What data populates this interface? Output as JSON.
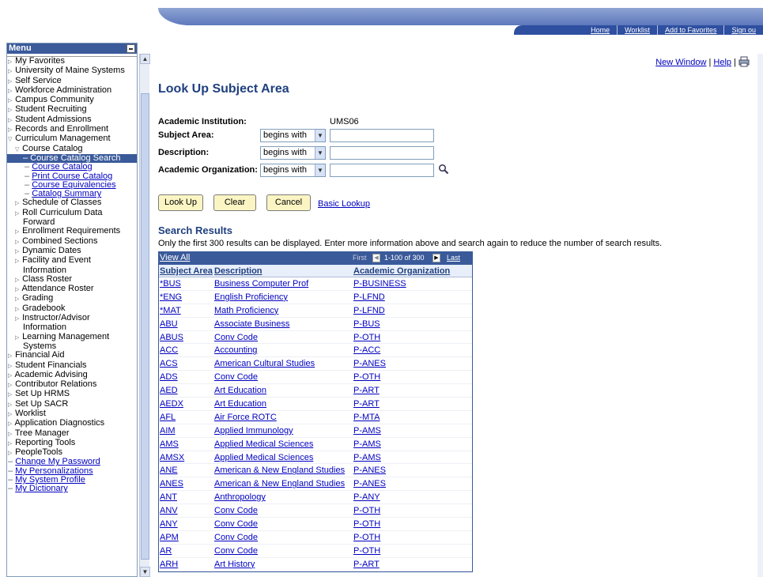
{
  "header": {
    "links": [
      "Home",
      "Worklist",
      "Add to Favorites",
      "Sign ou"
    ]
  },
  "menu": {
    "title": "Menu",
    "items": [
      {
        "label": "My Favorites",
        "level": 1,
        "arrow": "▷"
      },
      {
        "label": "University of Maine Systems",
        "level": 1,
        "arrow": "▷"
      },
      {
        "label": "Self Service",
        "level": 1,
        "arrow": "▷"
      },
      {
        "label": "Workforce Administration",
        "level": 1,
        "arrow": "▷"
      },
      {
        "label": "Campus Community",
        "level": 1,
        "arrow": "▷"
      },
      {
        "label": "Student Recruiting",
        "level": 1,
        "arrow": "▷"
      },
      {
        "label": "Student Admissions",
        "level": 1,
        "arrow": "▷"
      },
      {
        "label": "Records and Enrollment",
        "level": 1,
        "arrow": "▷"
      },
      {
        "label": "Curriculum Management",
        "level": 1,
        "arrow": "▽"
      },
      {
        "label": "Course Catalog",
        "level": 2,
        "arrow": "▽"
      },
      {
        "label": "– Course Catalog Search",
        "level": 3,
        "selected": true
      },
      {
        "label": "Course Catalog",
        "level": 3,
        "link": true
      },
      {
        "label": "Print Course Catalog",
        "level": 3,
        "link": true
      },
      {
        "label": "Course Equivalencies",
        "level": 3,
        "link": true
      },
      {
        "label": "Catalog Summary",
        "level": 3,
        "link": true
      },
      {
        "label": "Schedule of Classes",
        "level": 2,
        "arrow": "▷"
      },
      {
        "label": "Roll Curriculum Data",
        "level": 2,
        "arrow": "▷"
      },
      {
        "label": "Forward",
        "level": 2,
        "arrow": ""
      },
      {
        "label": "Enrollment Requirements",
        "level": 2,
        "arrow": "▷"
      },
      {
        "label": "Combined Sections",
        "level": 2,
        "arrow": "▷"
      },
      {
        "label": "Dynamic Dates",
        "level": 2,
        "arrow": "▷"
      },
      {
        "label": "Facility and Event",
        "level": 2,
        "arrow": "▷"
      },
      {
        "label": "Information",
        "level": 2,
        "arrow": ""
      },
      {
        "label": "Class Roster",
        "level": 2,
        "arrow": "▷"
      },
      {
        "label": "Attendance Roster",
        "level": 2,
        "arrow": "▷"
      },
      {
        "label": "Grading",
        "level": 2,
        "arrow": "▷"
      },
      {
        "label": "Gradebook",
        "level": 2,
        "arrow": "▷"
      },
      {
        "label": "Instructor/Advisor",
        "level": 2,
        "arrow": "▷"
      },
      {
        "label": "Information",
        "level": 2,
        "arrow": ""
      },
      {
        "label": "Learning Management",
        "level": 2,
        "arrow": "▷"
      },
      {
        "label": "Systems",
        "level": 2,
        "arrow": ""
      },
      {
        "label": "Financial Aid",
        "level": 0,
        "arrow": "▷"
      },
      {
        "label": "Student Financials",
        "level": 0,
        "arrow": "▷"
      },
      {
        "label": "Academic Advising",
        "level": 0,
        "arrow": "▷"
      },
      {
        "label": "Contributor Relations",
        "level": 0,
        "arrow": "▷"
      },
      {
        "label": "Set Up HRMS",
        "level": 0,
        "arrow": "▷"
      },
      {
        "label": "Set Up SACR",
        "level": 0,
        "arrow": "▷"
      },
      {
        "label": "Worklist",
        "level": 0,
        "arrow": "▷"
      },
      {
        "label": "Application Diagnostics",
        "level": 0,
        "arrow": "▷"
      },
      {
        "label": "Tree Manager",
        "level": 0,
        "arrow": "▷"
      },
      {
        "label": "Reporting Tools",
        "level": 0,
        "arrow": "▷"
      },
      {
        "label": "PeopleTools",
        "level": 0,
        "arrow": "▷"
      },
      {
        "label": "Change My Password",
        "level": 0,
        "link": true
      },
      {
        "label": "My Personalizations",
        "level": 0,
        "link": true
      },
      {
        "label": "My System Profile",
        "level": 0,
        "link": true
      },
      {
        "label": "My Dictionary",
        "level": 0,
        "link": true
      }
    ]
  },
  "toplinks": {
    "new_window": "New Window",
    "help": "Help"
  },
  "page": {
    "title": "Look Up Subject Area",
    "institution_label": "Academic Institution:",
    "institution_value": "UMS06",
    "subject_label": "Subject Area:",
    "description_label": "Description:",
    "org_label": "Academic Organization:",
    "operator": "begins with",
    "buttons": {
      "lookup": "Look Up",
      "clear": "Clear",
      "cancel": "Cancel",
      "basic": "Basic Lookup"
    },
    "results_title": "Search Results",
    "results_note": "Only the first 300 results can be displayed. Enter more information above and search again to reduce the number of search results."
  },
  "grid": {
    "view_all": "View All",
    "first": "First",
    "range": "1-100 of 300",
    "last": "Last",
    "columns": [
      "Subject Area",
      "Description",
      "Academic Organization"
    ],
    "rows": [
      [
        "*BUS",
        "Business Computer Prof",
        "P-BUSINESS"
      ],
      [
        "*ENG",
        "English Proficiency",
        "P-LFND"
      ],
      [
        "*MAT",
        "Math Proficiency",
        "P-LFND"
      ],
      [
        "ABU",
        "Associate Business",
        "P-BUS"
      ],
      [
        "ABUS",
        "Conv Code",
        "P-OTH"
      ],
      [
        "ACC",
        "Accounting",
        "P-ACC"
      ],
      [
        "ACS",
        "American Cultural Studies",
        "P-ANES"
      ],
      [
        "ADS",
        "Conv Code",
        "P-OTH"
      ],
      [
        "AED",
        "Art Education",
        "P-ART"
      ],
      [
        "AEDX",
        "Art Education",
        "P-ART"
      ],
      [
        "AFL",
        "Air Force ROTC",
        "P-MTA"
      ],
      [
        "AIM",
        "Applied Immunology",
        "P-AMS"
      ],
      [
        "AMS",
        "Applied Medical Sciences",
        "P-AMS"
      ],
      [
        "AMSX",
        "Applied Medical Sciences",
        "P-AMS"
      ],
      [
        "ANE",
        "American & New England Studies",
        "P-ANES"
      ],
      [
        "ANES",
        "American & New England Studies",
        "P-ANES"
      ],
      [
        "ANT",
        "Anthropology",
        "P-ANY"
      ],
      [
        "ANV",
        "Conv Code",
        "P-OTH"
      ],
      [
        "ANY",
        "Conv Code",
        "P-OTH"
      ],
      [
        "APM",
        "Conv Code",
        "P-OTH"
      ],
      [
        "AR",
        "Conv Code",
        "P-OTH"
      ],
      [
        "ARH",
        "Art History",
        "P-ART"
      ]
    ]
  }
}
